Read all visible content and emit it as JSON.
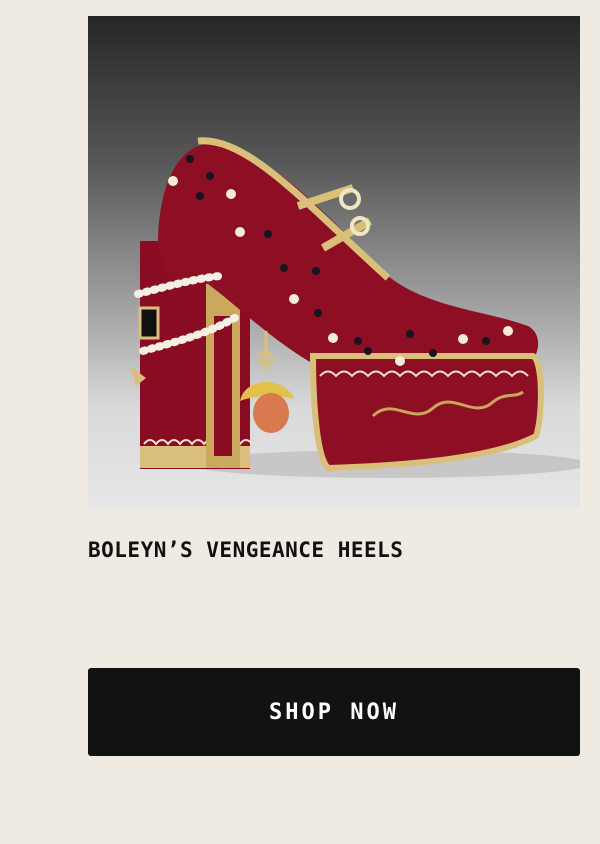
{
  "product": {
    "title": "BOLEYN’S VENGEANCE HEELS",
    "image_subject": "red velvet platform mary-jane heel with gold trim, studs, pearl strands and charm"
  },
  "cta": {
    "label": "SHOP NOW"
  },
  "colors": {
    "background": "#efebe2",
    "button": "#121214",
    "velvet": "#8e0f24",
    "gold": "#d9bf7a"
  }
}
